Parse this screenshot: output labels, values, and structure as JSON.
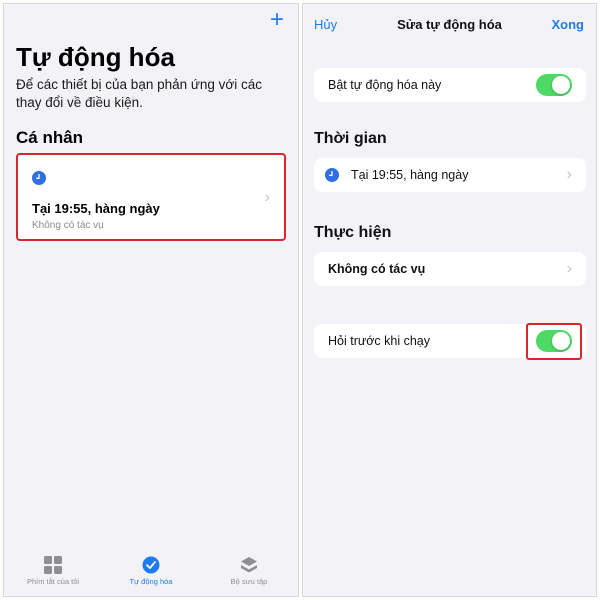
{
  "left": {
    "add_label": "+",
    "title": "Tự động hóa",
    "subtitle": "Để các thiết bị của bạn phản ứng với các thay đổi về điều kiện.",
    "section": "Cá nhân",
    "card": {
      "icon": "clock-icon",
      "title": "Tại 19:55, hàng ngày",
      "subtitle": "Không có tác vụ"
    },
    "tabs": [
      {
        "label": "Phím tắt của tôi",
        "icon": "grid-icon",
        "active": false
      },
      {
        "label": "Tự động hóa",
        "icon": "checkmark-clock-icon",
        "active": true
      },
      {
        "label": "Bộ sưu tập",
        "icon": "layers-icon",
        "active": false
      }
    ]
  },
  "right": {
    "nav": {
      "cancel": "Hủy",
      "title": "Sửa tự động hóa",
      "done": "Xong"
    },
    "enable_row": {
      "label": "Bật tự động hóa này",
      "on": true
    },
    "time_section": "Thời gian",
    "time_row": {
      "icon": "clock-icon",
      "label": "Tại 19:55, hàng ngày"
    },
    "action_section": "Thực hiện",
    "action_row": {
      "label": "Không có tác vụ"
    },
    "ask_row": {
      "label": "Hỏi trước khi chạy",
      "on": true
    }
  },
  "colors": {
    "accent": "#1e7cf2",
    "toggle_on": "#4cd964",
    "highlight": "#d7262f",
    "background": "#f2f2f7"
  }
}
